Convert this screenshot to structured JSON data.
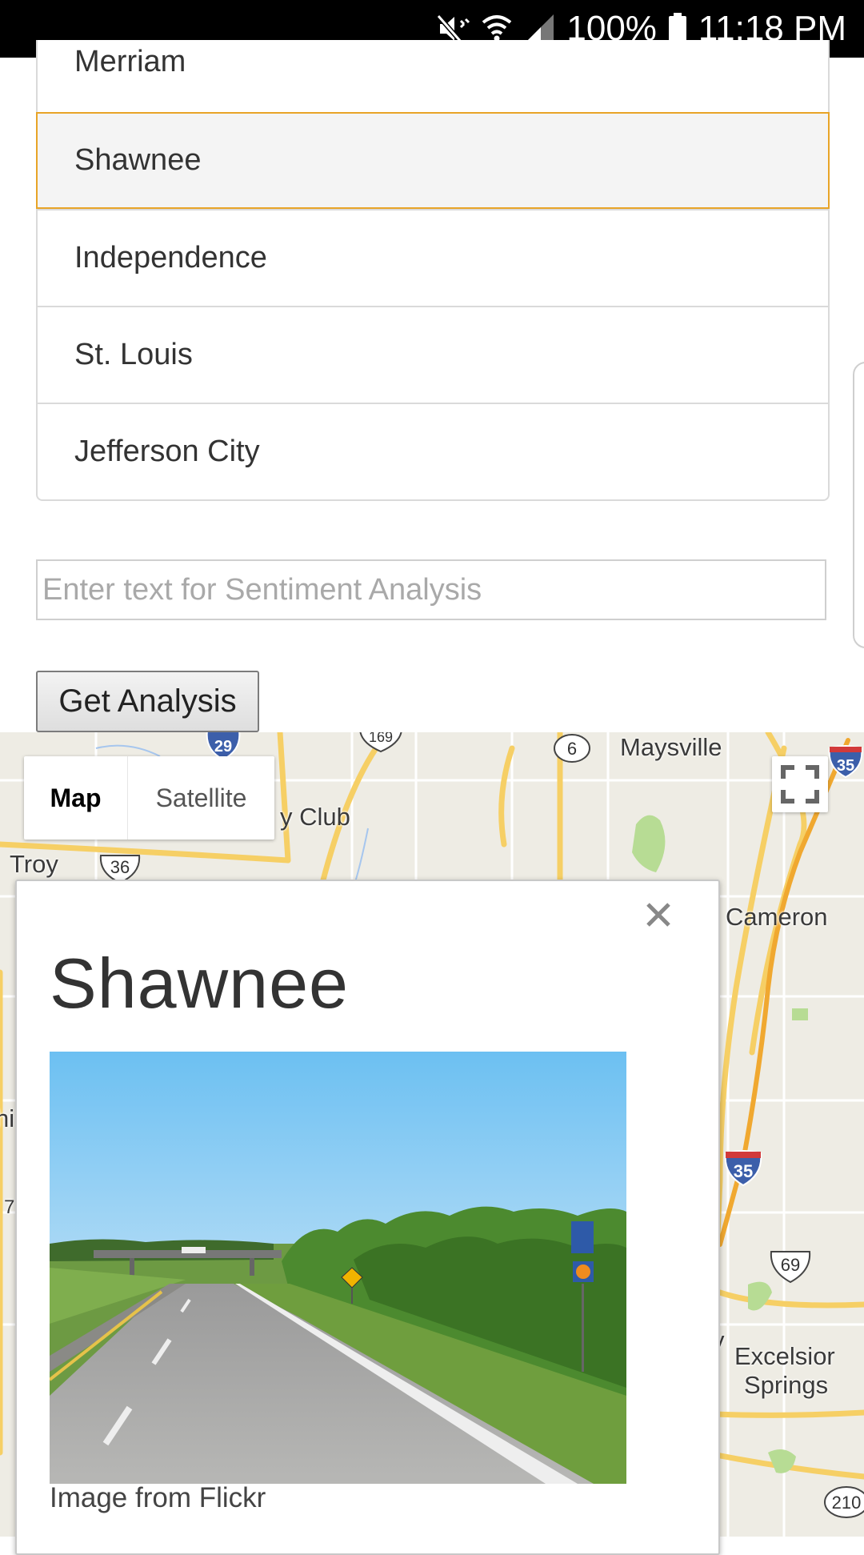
{
  "status_bar": {
    "battery": "100%",
    "time": "11:18 PM",
    "icons": [
      "mute-icon",
      "wifi-icon",
      "signal-icon",
      "battery-icon"
    ]
  },
  "city_list": {
    "items": [
      {
        "label": "Merriam"
      },
      {
        "label": "Shawnee",
        "selected": true
      },
      {
        "label": "Independence"
      },
      {
        "label": "St. Louis"
      },
      {
        "label": "Jefferson City"
      }
    ]
  },
  "sentiment": {
    "placeholder": "Enter text for Sentiment Analysis",
    "value": ""
  },
  "analysis_button": {
    "label": "Get Analysis"
  },
  "map": {
    "type_control": {
      "map_label": "Map",
      "satellite_label": "Satellite",
      "active": "Map"
    },
    "labels": {
      "maysville": "Maysville",
      "club": "y Club",
      "troy": "Troy",
      "cameron": "Cameron",
      "excelsior": "Excelsior",
      "springs": "Springs",
      "hi": "hi",
      "seven": "7",
      "y": "y"
    },
    "shields": {
      "i29": "29",
      "us169": "169",
      "r6": "6",
      "i35_top": "35",
      "us36": "36",
      "i35": "35",
      "us69": "69",
      "r210": "210"
    }
  },
  "infowindow": {
    "title": "Shawnee",
    "caption": "Image from Flickr"
  },
  "colors": {
    "selected_border": "#e8a427",
    "road_yellow": "#f6cf65",
    "interstate_blue": "#3c5faa",
    "map_bg": "#eeece4"
  }
}
